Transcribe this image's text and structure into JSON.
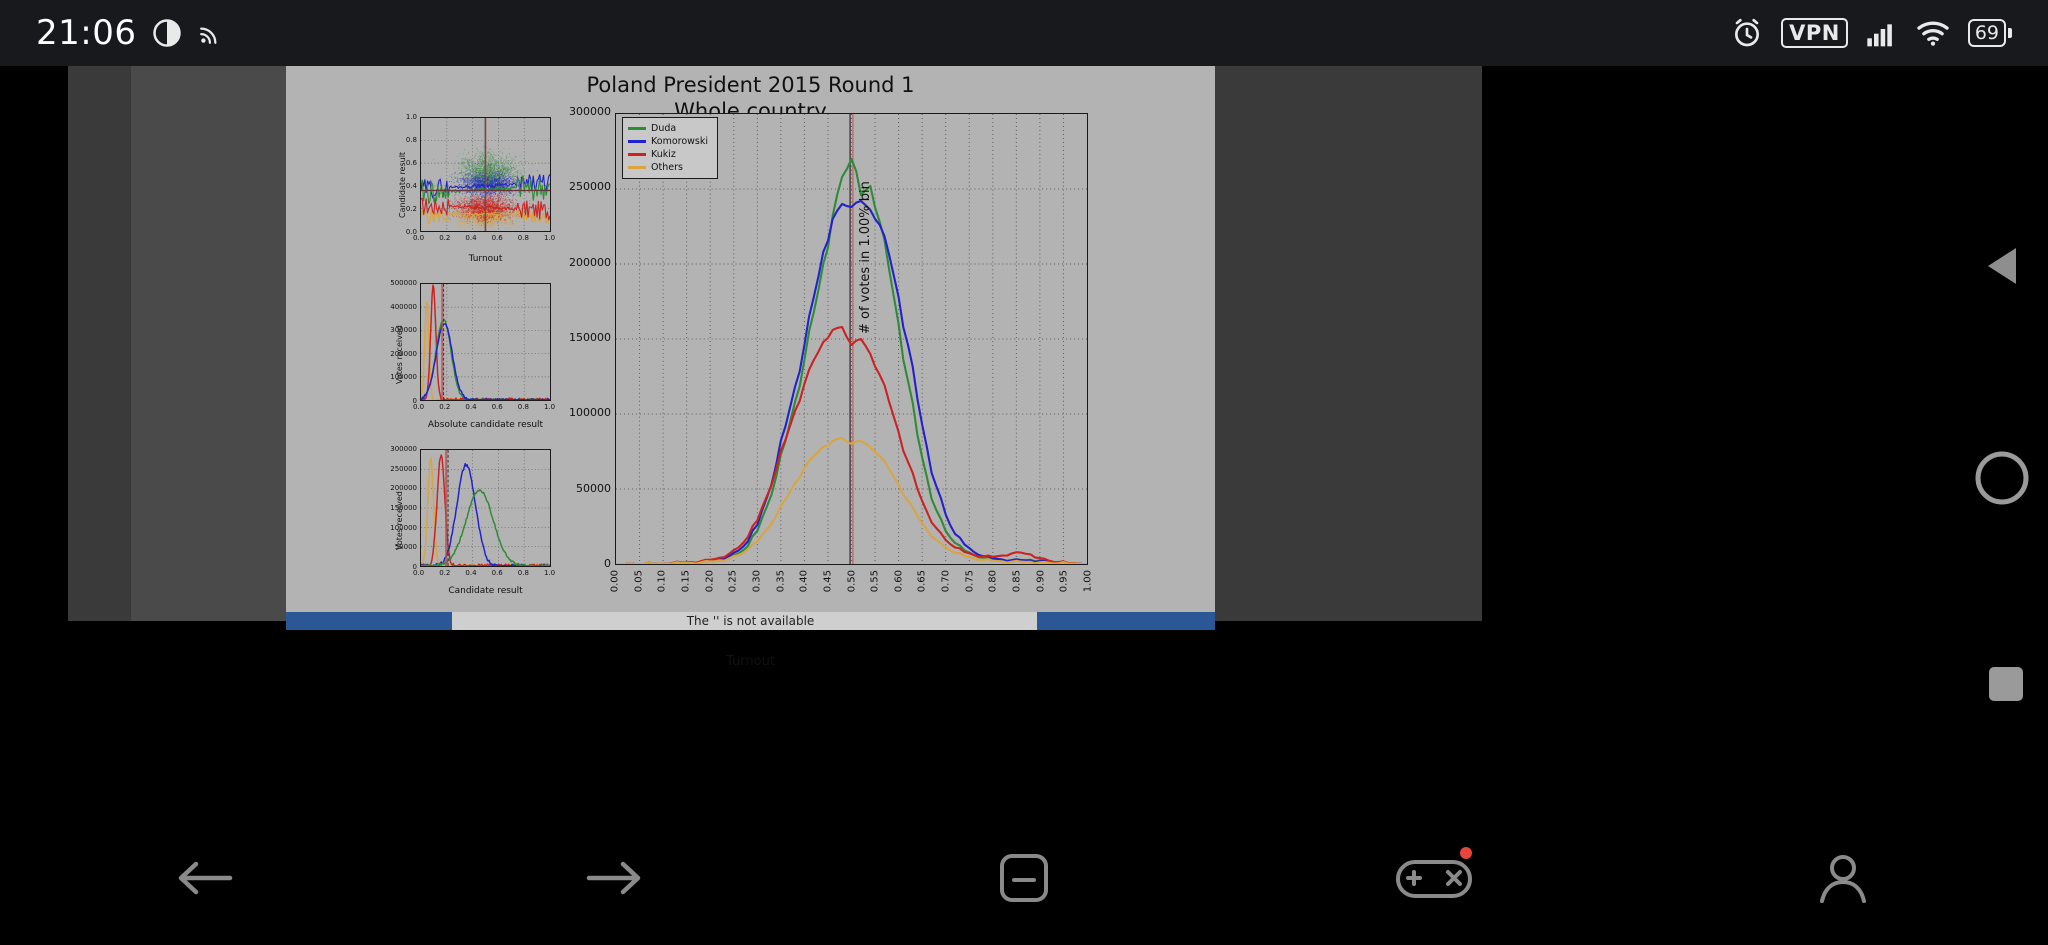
{
  "statusbar": {
    "time": "21:06",
    "icons": [
      "do-not-disturb-icon",
      "cast-icon",
      "alarm-icon",
      "vpn-icon",
      "cellular-signal-icon",
      "wifi-icon",
      "battery-icon"
    ],
    "vpn_label": "VPN",
    "battery_level": "69"
  },
  "navbar": {
    "back_label": "back-arrow",
    "forward_label": "forward-arrow",
    "home_label": "home",
    "games_label": "game-controller",
    "profile_label": "profile"
  },
  "edge_controls": {
    "play_label": "play-triangle",
    "record_label": "record-circle",
    "stop_label": "stop-square"
  },
  "appbar": {
    "message": "The '' is not available"
  },
  "chart_data": {
    "type": "line",
    "title": "Poland President 2015 Round 1",
    "subtitle": "Whole country",
    "xlabel": "Turnout",
    "ylabel": "# of votes in 1.00% bin",
    "xlim": [
      0.0,
      1.0
    ],
    "ylim": [
      0,
      300000
    ],
    "grid": true,
    "legend_position": "upper left",
    "yticks": [
      "0",
      "50000",
      "100000",
      "150000",
      "200000",
      "250000",
      "300000"
    ],
    "ytick_values": [
      0,
      50000,
      100000,
      150000,
      200000,
      250000,
      300000
    ],
    "xticks": [
      "0.00",
      "0.05",
      "0.10",
      "0.15",
      "0.20",
      "0.25",
      "0.30",
      "0.35",
      "0.40",
      "0.45",
      "0.50",
      "0.55",
      "0.60",
      "0.65",
      "0.70",
      "0.75",
      "0.80",
      "0.85",
      "0.90",
      "0.95",
      "1.00"
    ],
    "xtick_values": [
      0.0,
      0.05,
      0.1,
      0.15,
      0.2,
      0.25,
      0.3,
      0.35,
      0.4,
      0.45,
      0.5,
      0.55,
      0.6,
      0.65,
      0.7,
      0.75,
      0.8,
      0.85,
      0.9,
      0.95,
      1.0
    ],
    "colors": {
      "Duda": "#2e8b37",
      "Komorowski": "#2222cc",
      "Kukiz": "#cc2222",
      "Others": "#d9a441"
    },
    "markers": {
      "grey_vline": 0.497,
      "red_vline": 0.503
    },
    "x": [
      0.0,
      0.02,
      0.04,
      0.06,
      0.08,
      0.1,
      0.12,
      0.14,
      0.16,
      0.18,
      0.2,
      0.22,
      0.24,
      0.26,
      0.28,
      0.3,
      0.32,
      0.34,
      0.36,
      0.38,
      0.4,
      0.42,
      0.44,
      0.46,
      0.48,
      0.5,
      0.52,
      0.54,
      0.56,
      0.58,
      0.6,
      0.62,
      0.64,
      0.66,
      0.68,
      0.7,
      0.72,
      0.74,
      0.76,
      0.78,
      0.8,
      0.82,
      0.84,
      0.86,
      0.88,
      0.9,
      0.92,
      0.94,
      0.96,
      0.98,
      1.0
    ],
    "series": [
      {
        "name": "Duda",
        "color": "#2e8b37",
        "values": [
          0,
          0,
          0,
          0,
          0,
          200,
          500,
          700,
          900,
          1200,
          1800,
          2500,
          4000,
          7000,
          12000,
          22000,
          38000,
          58000,
          82000,
          108000,
          136000,
          168000,
          200000,
          232000,
          258000,
          270000,
          246000,
          252000,
          228000,
          196000,
          160000,
          122000,
          86000,
          58000,
          36000,
          22000,
          14000,
          9000,
          6000,
          4200,
          3200,
          2600,
          2400,
          2600,
          2800,
          2600,
          1800,
          1000,
          600,
          300,
          0
        ]
      },
      {
        "name": "Komorowski",
        "color": "#2222cc",
        "values": [
          0,
          0,
          0,
          0,
          0,
          200,
          500,
          800,
          1000,
          1400,
          2200,
          3200,
          5200,
          9000,
          15000,
          26000,
          44000,
          66000,
          92000,
          118000,
          146000,
          178000,
          208000,
          230000,
          240000,
          238000,
          242000,
          236000,
          226000,
          206000,
          178000,
          146000,
          110000,
          78000,
          52000,
          33000,
          20000,
          13000,
          8000,
          5200,
          3800,
          3000,
          2600,
          2600,
          2400,
          2000,
          1400,
          800,
          400,
          200,
          0
        ]
      },
      {
        "name": "Kukiz",
        "color": "#cc2222",
        "values": [
          0,
          0,
          0,
          0,
          0,
          300,
          700,
          1000,
          1300,
          1800,
          2800,
          4200,
          6800,
          11000,
          18000,
          29000,
          45000,
          63000,
          83000,
          102000,
          120000,
          136000,
          148000,
          156000,
          158000,
          146000,
          150000,
          140000,
          126000,
          108000,
          88000,
          68000,
          50000,
          35000,
          24000,
          16000,
          11000,
          8000,
          6000,
          5000,
          4800,
          5600,
          7000,
          7600,
          6400,
          4000,
          2200,
          1200,
          600,
          300,
          0
        ]
      },
      {
        "name": "Others",
        "color": "#d9a441",
        "values": [
          0,
          0,
          0,
          0,
          0,
          200,
          400,
          600,
          800,
          1100,
          1700,
          2500,
          3800,
          6000,
          9500,
          15000,
          23000,
          32000,
          43000,
          54000,
          64000,
          72000,
          78000,
          82000,
          84000,
          80000,
          82000,
          78000,
          72000,
          63000,
          53000,
          42000,
          32000,
          23000,
          16000,
          11000,
          7500,
          5200,
          3800,
          2800,
          2200,
          1800,
          1600,
          1600,
          1500,
          1200,
          800,
          500,
          300,
          150,
          0
        ]
      }
    ],
    "legend": [
      {
        "label": "Duda",
        "color": "#2e8b37"
      },
      {
        "label": "Komorowski",
        "color": "#2222cc"
      },
      {
        "label": "Kukiz",
        "color": "#cc2222"
      },
      {
        "label": "Others",
        "color": "#d9a441"
      }
    ]
  },
  "subplots": [
    {
      "id": "scatter-turnout-vs-result",
      "type": "scatter",
      "xlabel": "Turnout",
      "ylabel": "Candidate result",
      "xlim": [
        0.0,
        1.0
      ],
      "ylim": [
        0.0,
        1.0
      ],
      "xticks": [
        "0.0",
        "0.2",
        "0.4",
        "0.6",
        "0.8",
        "1.0"
      ],
      "yticks": [
        "0.0",
        "0.2",
        "0.4",
        "0.6",
        "0.8",
        "1.0"
      ],
      "markers": {
        "grey_vline": 0.497,
        "red_vline": 0.503,
        "hline": 0.36
      }
    },
    {
      "id": "votes-vs-absolute-result",
      "type": "line",
      "xlabel": "Absolute candidate result",
      "ylabel": "Votes received",
      "xlim": [
        0.0,
        1.0
      ],
      "ylim": [
        0,
        500000
      ],
      "xticks": [
        "0.0",
        "0.2",
        "0.4",
        "0.6",
        "0.8",
        "1.0"
      ],
      "yticks": [
        "0",
        "100000",
        "200000",
        "300000",
        "400000",
        "500000"
      ],
      "markers": {
        "red_vline": 0.165,
        "grey_vline": 0.175
      }
    },
    {
      "id": "votes-vs-candidate-result",
      "type": "line",
      "xlabel": "Candidate result",
      "ylabel": "Votes received",
      "xlim": [
        0.0,
        1.0
      ],
      "ylim": [
        0,
        300000
      ],
      "xticks": [
        "0.0",
        "0.2",
        "0.4",
        "0.6",
        "0.8",
        "1.0"
      ],
      "yticks": [
        "0",
        "50000",
        "100000",
        "150000",
        "200000",
        "250000",
        "300000"
      ],
      "markers": {
        "grey_vline": 0.21,
        "red_vline": 0.195
      }
    }
  ]
}
